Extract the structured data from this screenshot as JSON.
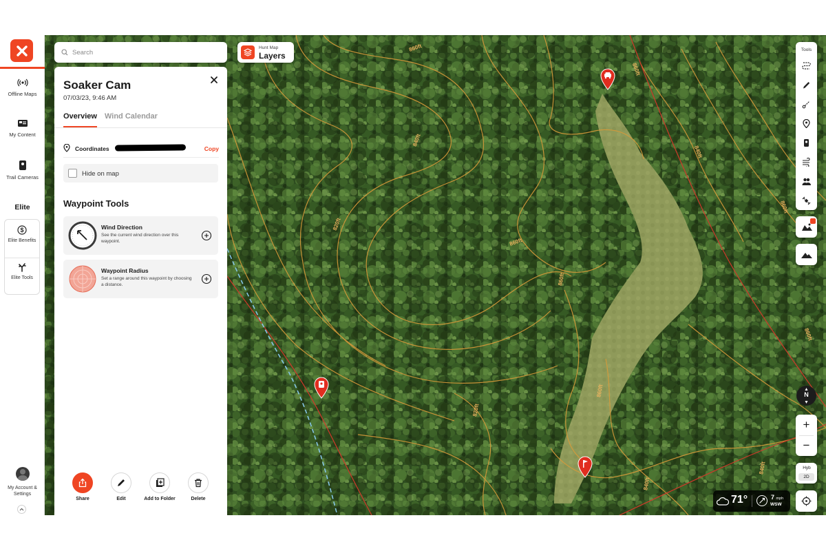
{
  "nav": {
    "offline_maps": "Offline Maps",
    "my_content": "My Content",
    "trail_cameras": "Trail Cameras",
    "elite_heading": "Elite",
    "elite_benefits": "Elite Benefits",
    "elite_tools": "Elite Tools",
    "account": "My Account & Settings"
  },
  "search": {
    "placeholder": "Search"
  },
  "layers": {
    "sub": "Hunt Map",
    "label": "Layers"
  },
  "panel": {
    "title": "Soaker Cam",
    "date": "07/03/23, 9:46 AM",
    "tabs": [
      "Overview",
      "Wind Calendar"
    ],
    "active_tab": "Overview",
    "coordinates_label": "Coordinates",
    "copy_label": "Copy",
    "hide_on_map": "Hide on map",
    "hide_on_map_checked": false,
    "waypoint_tools_heading": "Waypoint Tools",
    "tools": [
      {
        "name": "Wind Direction",
        "desc": "See the current wind direction over this waypoint."
      },
      {
        "name": "Waypoint Radius",
        "desc": "Set a range around this waypoint by choosing a distance."
      }
    ],
    "actions": [
      "Share",
      "Edit",
      "Add to Folder",
      "Delete"
    ]
  },
  "toolbar": {
    "title": "Tools",
    "tools": [
      "route-icon",
      "pencil-icon",
      "measure-icon",
      "marker-icon",
      "trail-camera-icon",
      "wind-icon",
      "group-icon",
      "satellite-icon"
    ]
  },
  "map": {
    "contour_labels": [
      "860ft",
      "860ft",
      "840ft",
      "820ft",
      "860ft",
      "860ft",
      "840ft",
      "860ft",
      "820ft",
      "860ft",
      "840ft",
      "840ft",
      "860ft"
    ],
    "waypoints": [
      "vehicle-pin-icon",
      "trail-camera-pin-icon",
      "flag-pin-icon"
    ]
  },
  "controls": {
    "compass_label": "N",
    "basemap_label": "Hyb",
    "view_mode": "2D",
    "zoom_in": "+",
    "zoom_out": "−"
  },
  "weather": {
    "temperature": "71°",
    "wind_speed": "7",
    "wind_unit": "mph",
    "wind_direction": "WSW"
  },
  "colors": {
    "accent": "#ef4523",
    "contour": "#d89a3a",
    "boundary": "#d0392a",
    "trail": "#86c5e6"
  }
}
